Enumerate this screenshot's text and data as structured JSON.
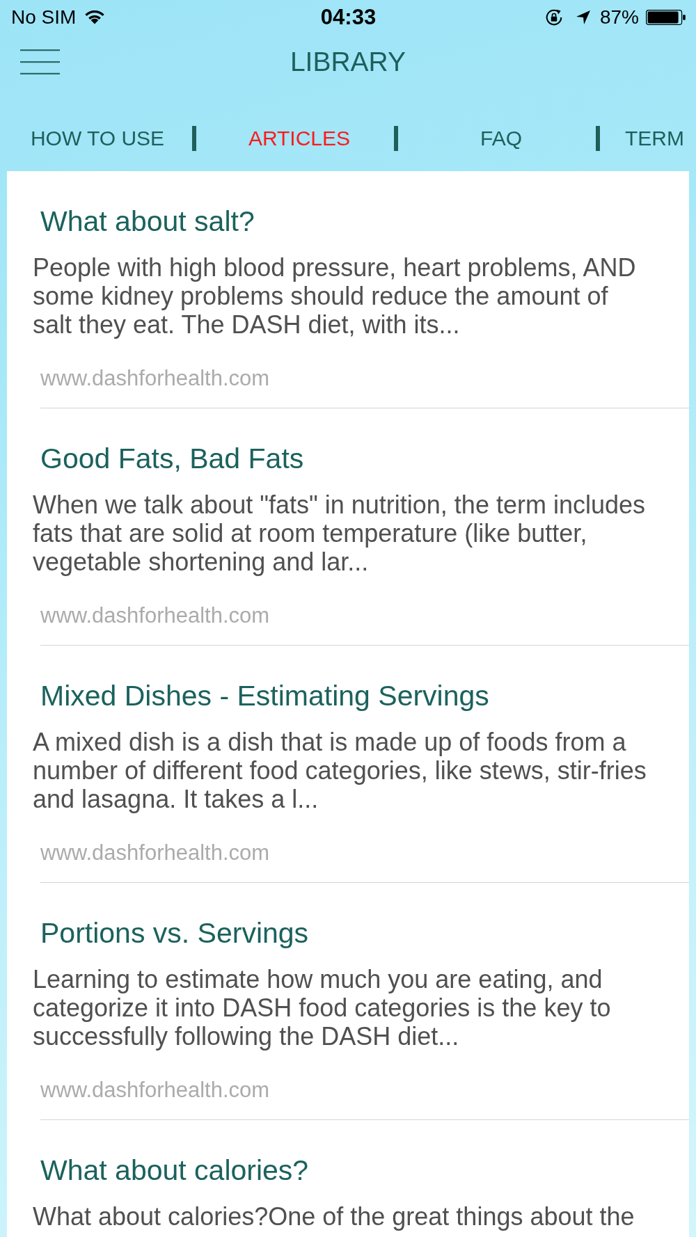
{
  "status_bar": {
    "carrier": "No SIM",
    "time": "04:33",
    "battery": "87%"
  },
  "header": {
    "title": "LIBRARY"
  },
  "tabs": [
    {
      "label": "HOW TO USE",
      "selected": false
    },
    {
      "label": "ARTICLES",
      "selected": true
    },
    {
      "label": "FAQ",
      "selected": false
    },
    {
      "label": "TERM",
      "selected": false
    }
  ],
  "articles": [
    {
      "title": "What about salt?",
      "summary": "People with high blood pressure, heart problems, AND some kidney problems should reduce the amount of salt they eat. The DASH diet, with its...",
      "source": "www.dashforhealth.com"
    },
    {
      "title": "Good Fats, Bad Fats",
      "summary": "When we talk about \"fats\" in nutrition, the term includes fats that are solid at room temperature (like butter, vegetable shortening and lar...",
      "source": "www.dashforhealth.com"
    },
    {
      "title": "Mixed Dishes - Estimating Servings",
      "summary": "A mixed dish is a dish that is made up of foods from a number of different food categories, like stews, stir-fries and lasagna. It takes a l...",
      "source": "www.dashforhealth.com"
    },
    {
      "title": "Portions vs. Servings",
      "summary": "Learning to estimate how much you are eating, and categorize it into DASH food categories is the key to successfully following the DASH diet...",
      "source": "www.dashforhealth.com"
    },
    {
      "title": "What about calories?",
      "summary": "What about calories?One of the great things about the"
    }
  ]
}
